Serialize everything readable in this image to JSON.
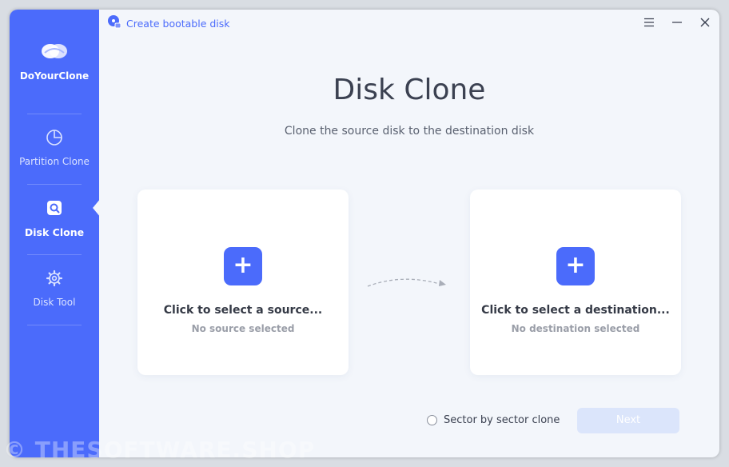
{
  "app": {
    "name": "DoYourClone"
  },
  "topbar": {
    "boot_label": "Create bootable disk",
    "icons": [
      "disk-icon",
      "menu-icon",
      "minimize-icon",
      "close-icon"
    ]
  },
  "sidebar": {
    "items": [
      {
        "label": "Partition Clone",
        "icon": "pie-chart-icon",
        "active": false
      },
      {
        "label": "Disk Clone",
        "icon": "disk-search-icon",
        "active": true
      },
      {
        "label": "Disk Tool",
        "icon": "gear-icon",
        "active": false
      }
    ]
  },
  "main": {
    "title": "Disk Clone",
    "subtitle": "Clone the source disk to the destination disk",
    "source": {
      "title": "Click to select a source...",
      "status": "No source selected"
    },
    "destination": {
      "title": "Click to select a destination...",
      "status": "No destination selected"
    },
    "plus_symbol": "+"
  },
  "footer": {
    "sector_label": "Sector by sector clone",
    "next_label": "Next"
  },
  "watermark": "© THESOFTWARE.SHOP",
  "colors": {
    "accent": "#4b6bfb",
    "background": "#f3f6fb",
    "disabled_button": "#dbe5fb"
  }
}
